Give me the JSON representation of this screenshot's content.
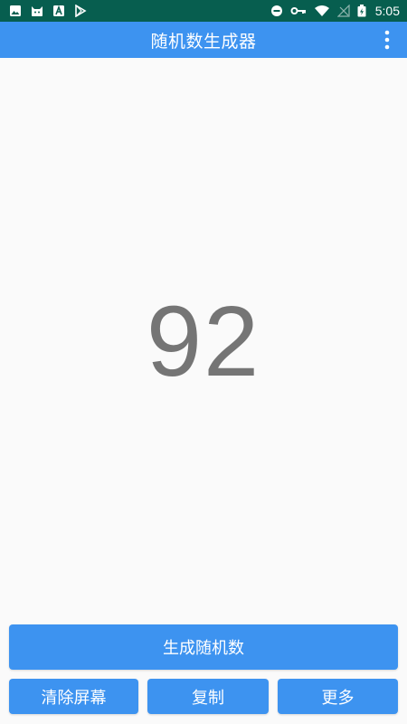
{
  "status_bar": {
    "time": "5:05",
    "left_icons": [
      "image-icon",
      "android-cat-icon",
      "font-a-icon",
      "play-store-icon"
    ],
    "right_icons": [
      "dnd-icon",
      "vpn-key-icon",
      "wifi-icon",
      "no-signal-icon",
      "battery-icon"
    ]
  },
  "app_bar": {
    "title": "随机数生成器",
    "menu_icon": "more-vert-icon"
  },
  "display": {
    "number": "92"
  },
  "buttons": {
    "generate": "生成随机数",
    "clear": "清除屏幕",
    "copy": "复制",
    "more": "更多"
  },
  "colors": {
    "status_bar": "#075e4f",
    "primary": "#3d93f0",
    "background": "#fafafa",
    "number": "#757575"
  }
}
